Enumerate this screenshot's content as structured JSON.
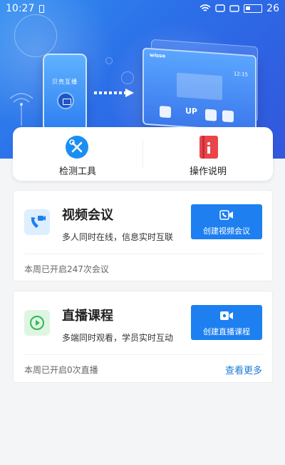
{
  "status_bar": {
    "time": "10:27",
    "battery_level": "26"
  },
  "hero": {
    "phone_title": "贝壳互播",
    "tablet_brand": "wisso",
    "tablet_clock": "12:15",
    "tablet_tile_label": "UP"
  },
  "tools": {
    "detect_label": "检测工具",
    "manual_label": "操作说明"
  },
  "meeting": {
    "title": "视频会议",
    "description": "多人同时在线，信息实时互联",
    "action_label": "创建视频会议",
    "stat": "本周已开启247次会议"
  },
  "live": {
    "title": "直播课程",
    "description": "多端同时观看，学员实时互动",
    "action_label": "创建直播课程",
    "stat": "本周已开启0次直播",
    "more_label": "查看更多"
  },
  "colors": {
    "accent": "#1d7ff0",
    "hero_start": "#2f8df0",
    "hero_end": "#3257dd",
    "link": "#1c7ad6"
  },
  "icons": {
    "detect": "wrench-screwdriver-icon",
    "manual": "manual-book-icon",
    "meeting": "phone-video-icon",
    "live": "play-circle-icon",
    "meeting_action": "video-call-icon",
    "live_action": "video-camera-icon"
  }
}
